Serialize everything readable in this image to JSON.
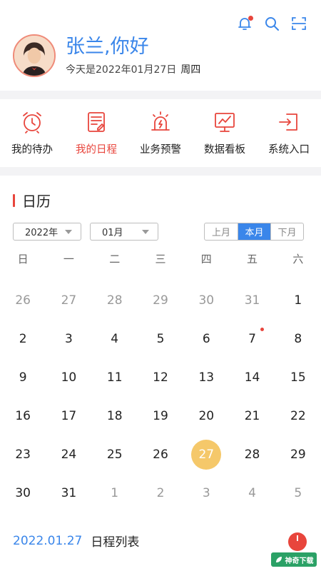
{
  "header": {
    "icons": [
      "bell-icon",
      "search-icon",
      "scan-icon"
    ],
    "greeting": "张兰,你好",
    "date_text": "今天是2022年01月27日",
    "weekday": "周四"
  },
  "quick_actions": [
    {
      "label": "我的待办",
      "icon": "alarm-clock-icon"
    },
    {
      "label": "我的日程",
      "icon": "schedule-note-icon"
    },
    {
      "label": "业务预警",
      "icon": "alarm-light-icon"
    },
    {
      "label": "数据看板",
      "icon": "data-board-icon"
    },
    {
      "label": "系统入口",
      "icon": "system-entry-icon"
    }
  ],
  "calendar": {
    "title": "日历",
    "year_select": "2022年",
    "month_select": "01月",
    "segments": [
      "上月",
      "本月",
      "下月"
    ],
    "active_segment": "本月",
    "weekdays": [
      "日",
      "一",
      "二",
      "三",
      "四",
      "五",
      "六"
    ],
    "weeks": [
      [
        {
          "d": "26",
          "out": true
        },
        {
          "d": "27",
          "out": true
        },
        {
          "d": "28",
          "out": true
        },
        {
          "d": "29",
          "out": true
        },
        {
          "d": "30",
          "out": true
        },
        {
          "d": "31",
          "out": true
        },
        {
          "d": "1"
        }
      ],
      [
        {
          "d": "2"
        },
        {
          "d": "3"
        },
        {
          "d": "4"
        },
        {
          "d": "5"
        },
        {
          "d": "6"
        },
        {
          "d": "7",
          "dot": true
        },
        {
          "d": "8"
        }
      ],
      [
        {
          "d": "9"
        },
        {
          "d": "10"
        },
        {
          "d": "11"
        },
        {
          "d": "12"
        },
        {
          "d": "13"
        },
        {
          "d": "14"
        },
        {
          "d": "15"
        }
      ],
      [
        {
          "d": "16"
        },
        {
          "d": "17"
        },
        {
          "d": "18"
        },
        {
          "d": "19"
        },
        {
          "d": "20"
        },
        {
          "d": "21"
        },
        {
          "d": "22"
        }
      ],
      [
        {
          "d": "23"
        },
        {
          "d": "24"
        },
        {
          "d": "25"
        },
        {
          "d": "26"
        },
        {
          "d": "27",
          "today": true
        },
        {
          "d": "28"
        },
        {
          "d": "29"
        }
      ],
      [
        {
          "d": "30"
        },
        {
          "d": "31"
        },
        {
          "d": "1",
          "out": true
        },
        {
          "d": "2",
          "out": true
        },
        {
          "d": "3",
          "out": true
        },
        {
          "d": "4",
          "out": true
        },
        {
          "d": "5",
          "out": true
        }
      ]
    ]
  },
  "schedule": {
    "date": "2022.01.27",
    "title": "日程列表"
  },
  "watermark": {
    "text": "神奇下载"
  },
  "colors": {
    "accent_blue": "#3a86ea",
    "accent_red": "#e8453c",
    "today_circle": "#f5c86a"
  }
}
